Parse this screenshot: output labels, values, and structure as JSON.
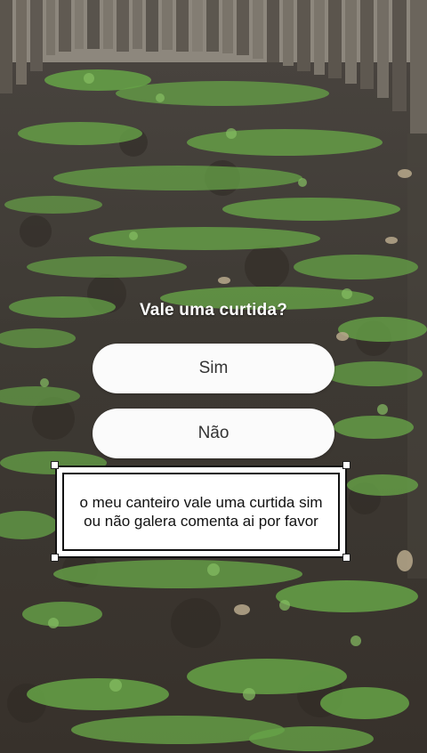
{
  "poll": {
    "question": "Vale uma curtida?",
    "options": [
      "Sim",
      "Não"
    ]
  },
  "caption": {
    "text": "o meu canteiro vale uma curtida sim\nou não galera comenta ai por favor"
  },
  "background": {
    "soil_color": "#3f3a33",
    "plant_color": "#5f9a3e",
    "fence_color": "#6f6a62"
  }
}
